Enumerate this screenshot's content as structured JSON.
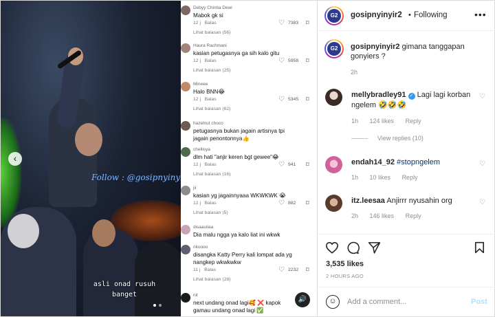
{
  "media": {
    "watermark": "Follow : @gosipnyinyir2",
    "caption_overlay": "asli onad rusuh banget",
    "prev_arrow": "‹",
    "comments": [
      {
        "user": "Debyy Chintia Dewi",
        "text": "Mabok gk si",
        "age": "12 j",
        "reply": "Balas",
        "likes": "7383",
        "more": "Lihat balasan (56)"
      },
      {
        "user": "Haura Rachmani",
        "text": "kasian petugasnya ga sih kalo gitu",
        "age": "12 j",
        "reply": "Balas",
        "likes": "5958",
        "more": "Lihat balasan (25)"
      },
      {
        "user": "Mineee",
        "text": "Halo BNN😂",
        "age": "12 j",
        "reply": "Balas",
        "likes": "5345",
        "more": "Lihat balasan (62)"
      },
      {
        "user": "hazelnut choco",
        "text": "petugasnya bukan jagain artisnya tpi jagain penontonnya👍",
        "age": "",
        "reply": "",
        "likes": "",
        "more": ""
      },
      {
        "user": "chellisya",
        "text": "dlm hati \"anjir keren bgt gewee\"😂",
        "age": "12 j",
        "reply": "Balas",
        "likes": "941",
        "more": "Lihat balasan (16)"
      },
      {
        "user": "jii",
        "text": "kasian yg jagainnyaaa WKWKWK 😭",
        "age": "12 j",
        "reply": "Balas",
        "likes": "882",
        "more": "Lihat balasan (5)"
      },
      {
        "user": "disaauliaa",
        "text": "Dia malu ngga ya kalo liat ini wkwk",
        "age": "",
        "reply": "",
        "likes": "",
        "more": ""
      },
      {
        "user": "rikoooo",
        "text": "disangka Katty Perry kali lompat ada yg nangkep wkwkwkw",
        "age": "11 j",
        "reply": "Balas",
        "likes": "2232",
        "more": "Lihat balasan (28)"
      },
      {
        "user": "nit",
        "text": "next undang onad lagi🥰 ❌ kapok gamau undang onad lagi ✅",
        "age": "",
        "reply": "",
        "likes": "",
        "more": ""
      }
    ]
  },
  "header": {
    "username": "gosipnyinyir2",
    "separator": "•",
    "follow_status": "Following",
    "more_icon": "•••"
  },
  "caption": {
    "username": "gosipnyinyir2",
    "text": "gimana tanggapan gonyiers ?",
    "time": "2h"
  },
  "comments": [
    {
      "username": "mellybradley91",
      "text": "Lagi lagi korban ngelem 🤣🤣🤣",
      "time": "1h",
      "likes": "124 likes",
      "reply": "Reply"
    },
    {
      "username": "endah14_92",
      "text": "#stopngelem",
      "time": "1h",
      "likes": "10 likes",
      "reply": "Reply"
    },
    {
      "username": "itz.leesaa",
      "text": "Anjirrr nyusahin org",
      "time": "2h",
      "likes": "146 likes",
      "reply": "Reply"
    }
  ],
  "view_replies": "View replies (10)",
  "likes": "3,535 likes",
  "posted_ago": "2 HOURS AGO",
  "add_comment": {
    "placeholder": "Add a comment...",
    "post_label": "Post",
    "emoji_icon": "☺"
  },
  "colors": {
    "verified": "#3897f0",
    "hashtag": "#00376b",
    "post_disabled": "#b2dffc"
  }
}
